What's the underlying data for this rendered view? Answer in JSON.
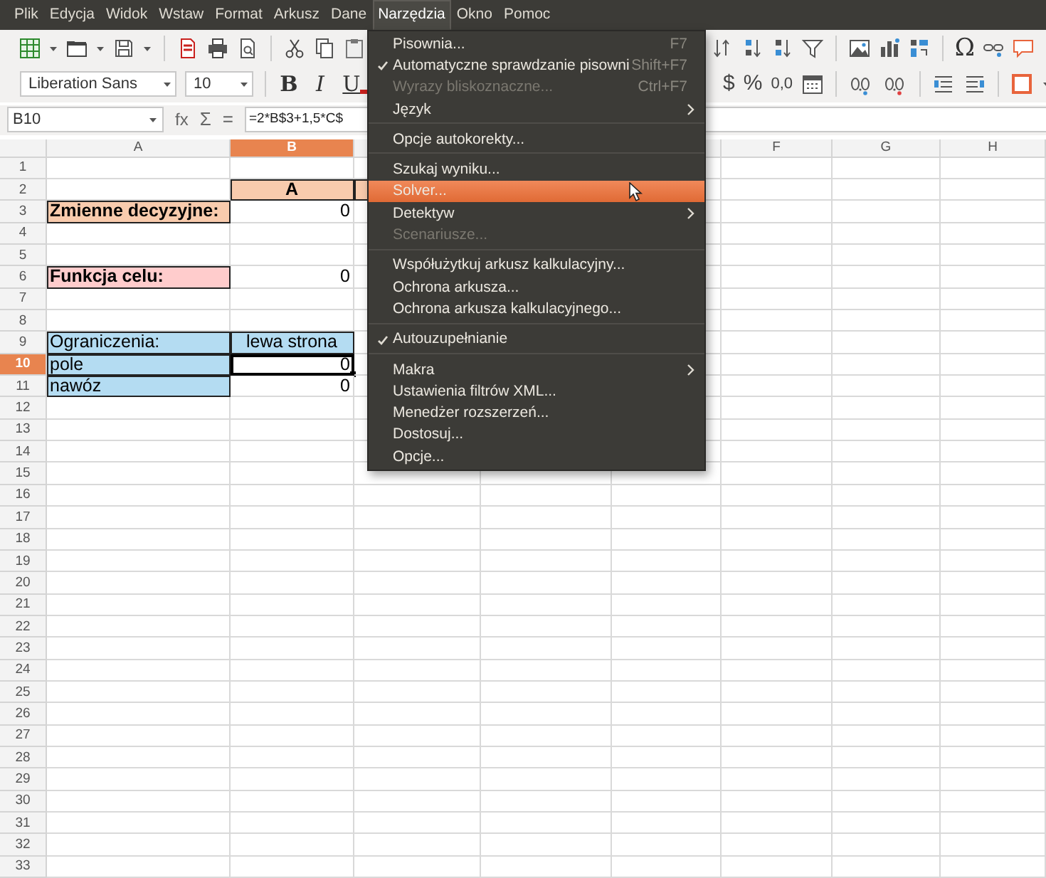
{
  "menubar": [
    {
      "label": "Plik",
      "selected": false
    },
    {
      "label": "Edycja",
      "selected": false
    },
    {
      "label": "Widok",
      "selected": false
    },
    {
      "label": "Wstaw",
      "selected": false
    },
    {
      "label": "Format",
      "selected": false
    },
    {
      "label": "Arkusz",
      "selected": false
    },
    {
      "label": "Dane",
      "selected": false
    },
    {
      "label": "Narzędzia",
      "selected": true
    },
    {
      "label": "Okno",
      "selected": false
    },
    {
      "label": "Pomoc",
      "selected": false
    }
  ],
  "formatting_toolbar": {
    "font_name": "Liberation Sans",
    "font_size": "10",
    "bold_button": "B",
    "italic_button": "I",
    "underline_button": "U",
    "currency_button": "$",
    "percent_button": "%",
    "number_button": "0,0"
  },
  "formula_bar": {
    "name_box": "B10",
    "function_wizard": "fx",
    "sum_button": "Σ",
    "equals_button": "=",
    "formula": "=2*B$3+1,5*C$"
  },
  "standard_toolbar": {
    "special_character_button": "Ω"
  },
  "sheet": {
    "columns_left": [
      {
        "label": "A",
        "selected": false
      },
      {
        "label": "B",
        "selected": true
      }
    ],
    "columns_right": [
      {
        "label": "F",
        "selected": false
      },
      {
        "label": "G",
        "selected": false
      },
      {
        "label": "H",
        "selected": false
      }
    ],
    "rows": [
      {
        "label": "1",
        "selected": false
      },
      {
        "label": "2",
        "selected": false,
        "cells": [
          {
            "color": "#ffffff",
            "bordered": false,
            "selected": false
          },
          {
            "text": "A",
            "kind": "text",
            "bold": true,
            "centered": true,
            "color": "#f8cbad",
            "bordered": true,
            "selected": false
          },
          {
            "color": "#f8cbad",
            "bordered": true,
            "selected": false
          }
        ]
      },
      {
        "label": "3",
        "selected": false,
        "cells": [
          {
            "text": "Zmienne decyzyjne:",
            "kind": "text",
            "bold": true,
            "centered": false,
            "color": "#f8cbad",
            "bordered": true,
            "selected": false
          },
          {
            "text": "0",
            "kind": "number",
            "bold": false,
            "centered": false,
            "color": "#ffffff",
            "bordered": false,
            "selected": false
          }
        ]
      },
      {
        "label": "4",
        "selected": false
      },
      {
        "label": "5",
        "selected": false
      },
      {
        "label": "6",
        "selected": false,
        "cells": [
          {
            "text": "Funkcja celu:",
            "kind": "text",
            "bold": true,
            "centered": false,
            "color": "#ffcccc",
            "bordered": true,
            "selected": false
          },
          {
            "text": "0",
            "kind": "number",
            "bold": false,
            "centered": false,
            "color": "#ffffff",
            "bordered": false,
            "selected": false
          }
        ]
      },
      {
        "label": "7",
        "selected": false
      },
      {
        "label": "8",
        "selected": false
      },
      {
        "label": "9",
        "selected": false,
        "cells": [
          {
            "text": "Ograniczenia:",
            "kind": "text",
            "bold": false,
            "centered": false,
            "color": "#b4dcf2",
            "bordered": true,
            "selected": false
          },
          {
            "text": "lewa strona",
            "kind": "text",
            "bold": false,
            "centered": true,
            "color": "#b4dcf2",
            "bordered": true,
            "selected": false
          }
        ]
      },
      {
        "label": "10",
        "selected": true,
        "cells": [
          {
            "text": "pole",
            "kind": "text",
            "bold": false,
            "centered": false,
            "color": "#b4dcf2",
            "bordered": true,
            "selected": false
          },
          {
            "text": "0",
            "kind": "number",
            "bold": false,
            "centered": false,
            "color": "#ffffff",
            "bordered": false,
            "selected": true
          }
        ]
      },
      {
        "label": "11",
        "selected": false,
        "cells": [
          {
            "text": "nawóz",
            "kind": "text",
            "bold": false,
            "centered": false,
            "color": "#b4dcf2",
            "bordered": true,
            "selected": false
          },
          {
            "text": "0",
            "kind": "number",
            "bold": false,
            "centered": false,
            "color": "#ffffff",
            "bordered": false,
            "selected": false
          }
        ]
      },
      {
        "label": "12",
        "selected": false
      },
      {
        "label": "13",
        "selected": false
      },
      {
        "label": "14",
        "selected": false
      },
      {
        "label": "15",
        "selected": false
      },
      {
        "label": "16",
        "selected": false
      },
      {
        "label": "17",
        "selected": false
      },
      {
        "label": "18",
        "selected": false
      },
      {
        "label": "19",
        "selected": false
      },
      {
        "label": "20",
        "selected": false
      },
      {
        "label": "21",
        "selected": false
      },
      {
        "label": "22",
        "selected": false
      },
      {
        "label": "23",
        "selected": false
      },
      {
        "label": "24",
        "selected": false
      },
      {
        "label": "25",
        "selected": false
      },
      {
        "label": "26",
        "selected": false
      },
      {
        "label": "27",
        "selected": false
      },
      {
        "label": "28",
        "selected": false
      },
      {
        "label": "29",
        "selected": false
      },
      {
        "label": "30",
        "selected": false
      },
      {
        "label": "31",
        "selected": false
      },
      {
        "label": "32",
        "selected": false
      },
      {
        "label": "33",
        "selected": false
      }
    ]
  },
  "tools_menu": {
    "sections": [
      [
        {
          "label": "Pisownia...",
          "shortcut": "F7",
          "checked": false,
          "disabled": false,
          "submenu": false,
          "selected": false
        },
        {
          "label": "Automatyczne sprawdzanie pisowni",
          "shortcut": "Shift+F7",
          "checked": true,
          "disabled": false,
          "submenu": false,
          "selected": false
        },
        {
          "label": "Wyrazy bliskoznaczne...",
          "shortcut": "Ctrl+F7",
          "checked": false,
          "disabled": true,
          "submenu": false,
          "selected": false
        },
        {
          "label": "Język",
          "checked": false,
          "disabled": false,
          "submenu": true,
          "selected": false
        }
      ],
      [
        {
          "label": "Opcje autokorekty...",
          "checked": false,
          "disabled": false,
          "submenu": false,
          "selected": false
        }
      ],
      [
        {
          "label": "Szukaj wyniku...",
          "checked": false,
          "disabled": false,
          "submenu": false,
          "selected": false
        },
        {
          "label": "Solver...",
          "checked": false,
          "disabled": false,
          "submenu": false,
          "selected": true
        },
        {
          "label": "Detektyw",
          "checked": false,
          "disabled": false,
          "submenu": true,
          "selected": false
        },
        {
          "label": "Scenariusze...",
          "checked": false,
          "disabled": true,
          "submenu": false,
          "selected": false
        }
      ],
      [
        {
          "label": "Współużytkuj arkusz kalkulacyjny...",
          "checked": false,
          "disabled": false,
          "submenu": false,
          "selected": false
        },
        {
          "label": "Ochrona arkusza...",
          "checked": false,
          "disabled": false,
          "submenu": false,
          "selected": false
        },
        {
          "label": "Ochrona arkusza kalkulacyjnego...",
          "checked": false,
          "disabled": false,
          "submenu": false,
          "selected": false
        }
      ],
      [
        {
          "label": "Autouzupełnianie",
          "checked": true,
          "disabled": false,
          "submenu": false,
          "selected": false
        }
      ],
      [
        {
          "label": "Makra",
          "checked": false,
          "disabled": false,
          "submenu": true,
          "selected": false
        },
        {
          "label": "Ustawienia filtrów XML...",
          "checked": false,
          "disabled": false,
          "submenu": false,
          "selected": false
        },
        {
          "label": "Menedżer rozszerzeń...",
          "checked": false,
          "disabled": false,
          "submenu": false,
          "selected": false
        },
        {
          "label": "Dostosuj...",
          "checked": false,
          "disabled": false,
          "submenu": false,
          "selected": false
        },
        {
          "label": "Opcje...",
          "checked": false,
          "disabled": false,
          "submenu": false,
          "selected": false
        }
      ]
    ]
  }
}
